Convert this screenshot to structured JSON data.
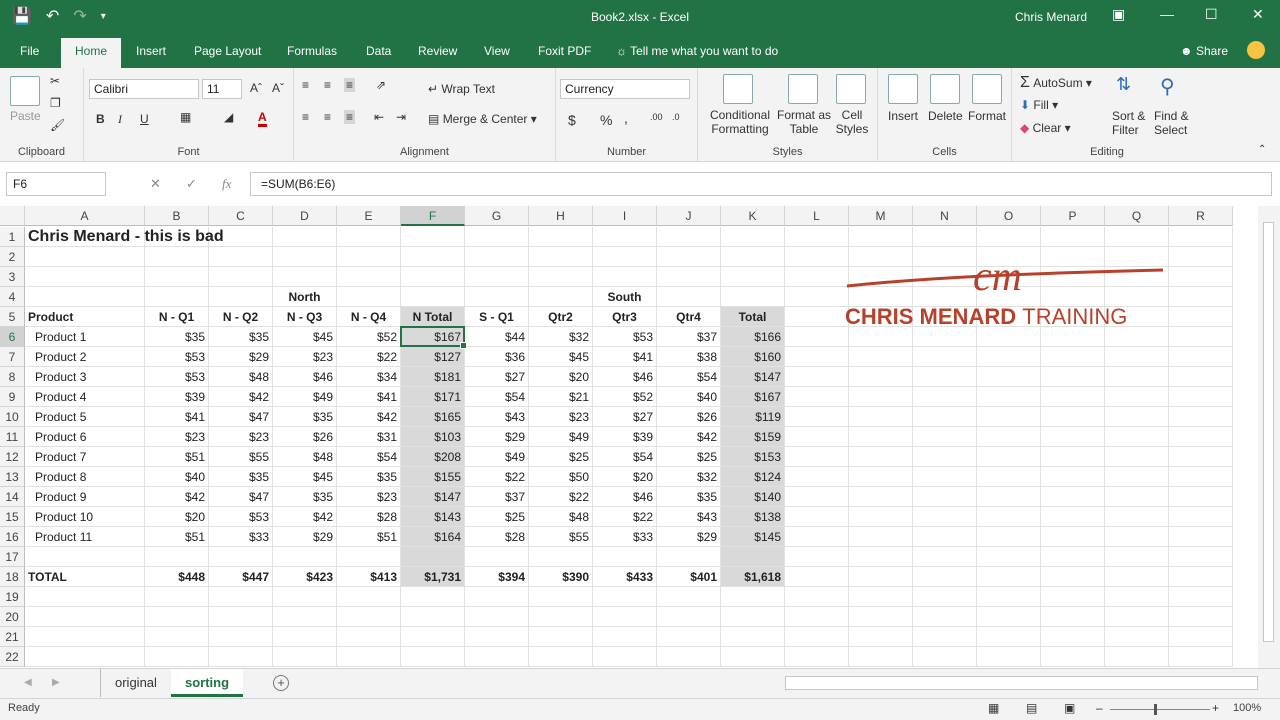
{
  "window": {
    "title": "Book2.xlsx  -  Excel",
    "user": "Chris Menard"
  },
  "tabs": [
    "File",
    "Home",
    "Insert",
    "Page Layout",
    "Formulas",
    "Data",
    "Review",
    "View",
    "Foxit PDF"
  ],
  "tell_me": "Tell me what you want to do",
  "share": "Share",
  "ribbon": {
    "clipboard": {
      "paste": "Paste",
      "label": "Clipboard"
    },
    "font": {
      "name": "Calibri",
      "size": "11",
      "label": "Font",
      "bold": "B",
      "italic": "I",
      "underline": "U"
    },
    "alignment": {
      "wrap_text": "Wrap Text",
      "merge_center": "Merge & Center",
      "label": "Alignment"
    },
    "number": {
      "format": "Currency",
      "label": "Number",
      "currency": "$",
      "percent": "%",
      "comma": ","
    },
    "styles": {
      "conditional": [
        "Conditional",
        "Formatting"
      ],
      "format_table": [
        "Format as",
        "Table"
      ],
      "cell_styles": [
        "Cell",
        "Styles"
      ],
      "label": "Styles"
    },
    "cells": {
      "insert": "Insert",
      "delete": "Delete",
      "format": "Format",
      "label": "Cells"
    },
    "editing": {
      "autosum": "AutoSum",
      "fill": "Fill",
      "clear": "Clear",
      "sort_filter": [
        "Sort &",
        "Filter"
      ],
      "find_select": [
        "Find &",
        "Select"
      ],
      "label": "Editing"
    }
  },
  "formula_bar": {
    "name_box": "F6",
    "fx": "fx",
    "formula": "=SUM(B6:E6)"
  },
  "columns": [
    "A",
    "B",
    "C",
    "D",
    "E",
    "F",
    "G",
    "H",
    "I",
    "J",
    "K",
    "L",
    "M",
    "N",
    "O",
    "P",
    "Q",
    "R"
  ],
  "rows": [
    "1",
    "2",
    "3",
    "4",
    "5",
    "6",
    "7",
    "8",
    "9",
    "10",
    "11",
    "12",
    "13",
    "14",
    "15",
    "16",
    "17",
    "18",
    "19",
    "20",
    "21",
    "22"
  ],
  "sheet": {
    "title": "Chris Menard - this is bad",
    "group_north": "North",
    "group_south": "South",
    "headers": [
      "Product",
      "N - Q1",
      "N - Q2",
      "N - Q3",
      "N - Q4",
      "N Total",
      "S - Q1",
      "Qtr2",
      "Qtr3",
      "Qtr4",
      "Total"
    ],
    "products": [
      [
        "Product 1",
        "$35",
        "$35",
        "$45",
        "$52",
        "$167",
        "$44",
        "$32",
        "$53",
        "$37",
        "$166"
      ],
      [
        "Product 2",
        "$53",
        "$29",
        "$23",
        "$22",
        "$127",
        "$36",
        "$45",
        "$41",
        "$38",
        "$160"
      ],
      [
        "Product 3",
        "$53",
        "$48",
        "$46",
        "$34",
        "$181",
        "$27",
        "$20",
        "$46",
        "$54",
        "$147"
      ],
      [
        "Product 4",
        "$39",
        "$42",
        "$49",
        "$41",
        "$171",
        "$54",
        "$21",
        "$52",
        "$40",
        "$167"
      ],
      [
        "Product 5",
        "$41",
        "$47",
        "$35",
        "$42",
        "$165",
        "$43",
        "$23",
        "$27",
        "$26",
        "$119"
      ],
      [
        "Product 6",
        "$23",
        "$23",
        "$26",
        "$31",
        "$103",
        "$29",
        "$49",
        "$39",
        "$42",
        "$159"
      ],
      [
        "Product 7",
        "$51",
        "$55",
        "$48",
        "$54",
        "$208",
        "$49",
        "$25",
        "$54",
        "$25",
        "$153"
      ],
      [
        "Product 8",
        "$40",
        "$35",
        "$45",
        "$35",
        "$155",
        "$22",
        "$50",
        "$20",
        "$32",
        "$124"
      ],
      [
        "Product 9",
        "$42",
        "$47",
        "$35",
        "$23",
        "$147",
        "$37",
        "$22",
        "$46",
        "$35",
        "$140"
      ],
      [
        "Product 10",
        "$20",
        "$53",
        "$42",
        "$28",
        "$143",
        "$25",
        "$48",
        "$22",
        "$43",
        "$138"
      ],
      [
        "Product 11",
        "$51",
        "$33",
        "$29",
        "$51",
        "$164",
        "$28",
        "$55",
        "$33",
        "$29",
        "$145"
      ]
    ],
    "total": [
      "TOTAL",
      "$448",
      "$447",
      "$423",
      "$413",
      "$1,731",
      "$394",
      "$390",
      "$433",
      "$401",
      "$1,618"
    ]
  },
  "logo": {
    "initials": "cm",
    "company": "CHRIS MENARD",
    "suffix": "TRAINING"
  },
  "sheet_tabs": [
    {
      "name": "original"
    },
    {
      "name": "sorting"
    }
  ],
  "active_sheet": "sorting",
  "status": {
    "ready": "Ready",
    "zoom": "100%"
  },
  "colors": {
    "excel_green": "#217346",
    "logo_red": "#b8412c",
    "shade": "#d9d9d9"
  }
}
